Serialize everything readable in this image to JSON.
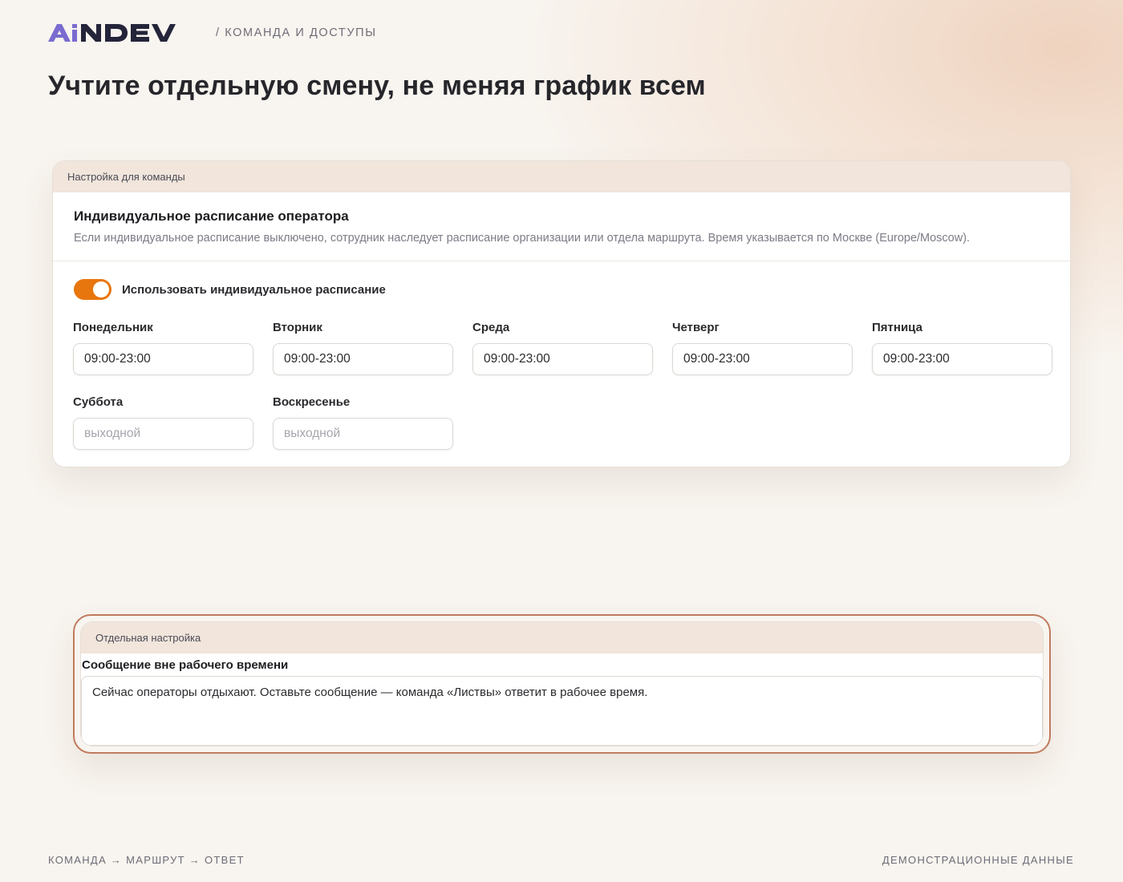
{
  "brand": {
    "logo_text": "AiNDEV",
    "colors": {
      "accent": "#7a6cd0",
      "dark": "#24243a"
    }
  },
  "breadcrumb": "/ КОМАНДА И ДОСТУПЫ",
  "headline": "Учтите отдельную смену, не меняя график всем",
  "schedule_card": {
    "tab_label": "Настройка для команды",
    "title": "Индивидуальное расписание оператора",
    "description": "Если индивидуальное расписание выключено, сотрудник наследует расписание организации или отдела маршрута. Время указывается по Москве (Europe/Moscow).",
    "toggle": {
      "label": "Использовать индивидуальное расписание",
      "on": true,
      "color": "#e8760e"
    },
    "days": [
      {
        "label": "Понедельник",
        "value": "09:00-23:00",
        "placeholder": ""
      },
      {
        "label": "Вторник",
        "value": "09:00-23:00",
        "placeholder": ""
      },
      {
        "label": "Среда",
        "value": "09:00-23:00",
        "placeholder": ""
      },
      {
        "label": "Четверг",
        "value": "09:00-23:00",
        "placeholder": ""
      },
      {
        "label": "Пятница",
        "value": "09:00-23:00",
        "placeholder": ""
      },
      {
        "label": "Суббота",
        "value": "",
        "placeholder": "выходной"
      },
      {
        "label": "Воскресенье",
        "value": "",
        "placeholder": "выходной"
      }
    ]
  },
  "message_card": {
    "tab_label": "Отдельная настройка",
    "field_label": "Сообщение вне рабочего времени",
    "value": "Сейчас операторы отдыхают. Оставьте сообщение — команда «Листвы» ответит в рабочее время.",
    "highlight_color": "#c07b5e"
  },
  "footer": {
    "left": "КОМАНДА → МАРШРУТ → ОТВЕТ",
    "right": "ДЕМОНСТРАЦИОННЫЕ ДАННЫЕ"
  }
}
